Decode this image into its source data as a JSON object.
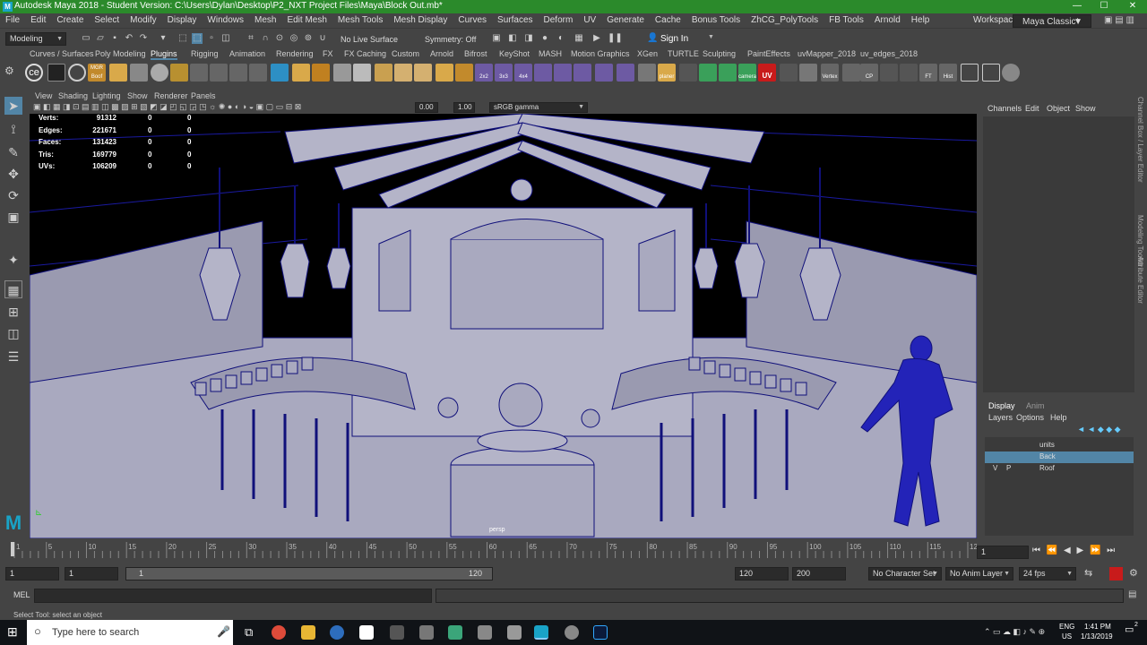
{
  "window": {
    "title": "Autodesk Maya 2018 - Student Version: C:\\Users\\Dylan\\Desktop\\P2_NXT Project Files\\Maya\\Block Out.mb*",
    "minimize": "—",
    "maximize": "☐",
    "close": "✕"
  },
  "menu": [
    "File",
    "Edit",
    "Create",
    "Select",
    "Modify",
    "Display",
    "Windows",
    "Mesh",
    "Edit Mesh",
    "Mesh Tools",
    "Mesh Display",
    "Curves",
    "Surfaces",
    "Deform",
    "UV",
    "Generate",
    "Cache",
    "Bonus Tools",
    "ZhCG_PolyTools",
    "FB Tools",
    "Arnold",
    "Help"
  ],
  "workspace": {
    "label": "Workspace :",
    "value": "Maya Classic*"
  },
  "statusline": {
    "mode": "Modeling",
    "live_surface": "No Live Surface",
    "symmetry": "Symmetry: Off",
    "sign_in": "Sign In"
  },
  "shelf_tabs": [
    "Curves / Surfaces",
    "Poly Modeling",
    "Plugins",
    "Rigging",
    "Animation",
    "Rendering",
    "FX",
    "FX Caching",
    "Custom",
    "Arnold",
    "Bifrost",
    "KeyShot",
    "MASH",
    "Motion Graphics",
    "XGen",
    "TURTLE",
    "Sculpting",
    "PaintEffects",
    "uvMapper_2018",
    "uv_edges_2018"
  ],
  "shelf_active": "Plugins",
  "shelf_labels": [
    "MGR Boof",
    "2x2",
    "3x3",
    "4x4",
    "planer",
    "camera",
    "UV",
    "Vertex",
    "CP",
    "FT",
    "Hist"
  ],
  "panel_menu": [
    "View",
    "Shading",
    "Lighting",
    "Show",
    "Renderer",
    "Panels"
  ],
  "panel_tools": {
    "exposure": "0.00",
    "gamma": "1.00",
    "colorspace": "sRGB gamma"
  },
  "hud": [
    {
      "label": "Verts:",
      "a": "91312",
      "b": "0",
      "c": "0"
    },
    {
      "label": "Edges:",
      "a": "221671",
      "b": "0",
      "c": "0"
    },
    {
      "label": "Faces:",
      "a": "131423",
      "b": "0",
      "c": "0"
    },
    {
      "label": "Tris:",
      "a": "169779",
      "b": "0",
      "c": "0"
    },
    {
      "label": "UVs:",
      "a": "106209",
      "b": "0",
      "c": "0"
    }
  ],
  "camera_label": "persp",
  "channel_box": {
    "menu": [
      "Channels",
      "Edit",
      "Object",
      "Show"
    ]
  },
  "side_tabs": [
    "Channel Box / Layer Editor",
    "Modeling Toolkit",
    "Attribute Editor"
  ],
  "layer_editor": {
    "tabs": [
      "Display",
      "Anim"
    ],
    "menu": [
      "Layers",
      "Options",
      "Help"
    ],
    "layers": [
      {
        "v": "",
        "p": "",
        "name": "units",
        "selected": false
      },
      {
        "v": "",
        "p": "",
        "name": "Back",
        "selected": true
      },
      {
        "v": "V",
        "p": "P",
        "name": "Roof",
        "selected": false
      }
    ]
  },
  "timeline": {
    "ticks": [
      "1",
      "5",
      "10",
      "15",
      "20",
      "25",
      "30",
      "35",
      "40",
      "45",
      "50",
      "55",
      "60",
      "65",
      "70",
      "75",
      "80",
      "85",
      "90",
      "95",
      "100",
      "105",
      "110",
      "115",
      "120"
    ],
    "current": "1"
  },
  "range": {
    "start": "1",
    "start2": "1",
    "slider_start": "1",
    "slider_end": "120",
    "end": "120",
    "end2": "200",
    "character_set": "No Character Set",
    "anim_layer": "No Anim Layer",
    "fps": "24 fps"
  },
  "cmdline": {
    "lang": "MEL"
  },
  "helpline": "Select Tool: select an object",
  "taskbar": {
    "search_placeholder": "Type here to search",
    "lang": "ENG",
    "region": "US",
    "time": "1:41 PM",
    "date": "1/13/2019",
    "notif_count": "2"
  },
  "colors": {
    "title_green": "#2b8a2b",
    "maya_bg": "#444444",
    "viewport_bg": "#000000",
    "mesh_fill": "#a9a9bf",
    "wire": "#10107a",
    "selection": "#5285a6"
  }
}
